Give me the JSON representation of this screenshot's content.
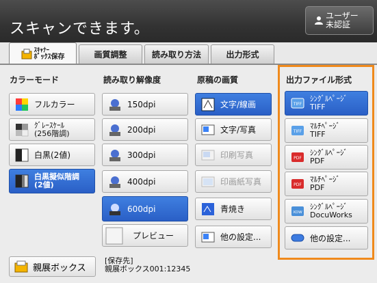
{
  "header": {
    "status": "スキャンできます。",
    "user_line1": "ユーザー",
    "user_line2": "未認証"
  },
  "tabs": {
    "scanbox_line1": "ｽｷｬﾅｰ",
    "scanbox_line2": "ﾎﾞｯｸｽ保存",
    "image_quality": "画質調整",
    "scan_method": "読み取り方法",
    "output_format": "出力形式"
  },
  "color_mode": {
    "heading": "カラーモード",
    "full_color": "フルカラー",
    "gray_line1": "ｸﾞﾚｰｽｹｰﾙ",
    "gray_line2": "(256階調)",
    "bw": "白黒(2値)",
    "bw_pseudo_line1": "白黒擬似階調",
    "bw_pseudo_line2": "(2値)"
  },
  "resolution": {
    "heading": "読み取り解像度",
    "r150": "150dpi",
    "r200": "200dpi",
    "r300": "300dpi",
    "r400": "400dpi",
    "r600": "600dpi",
    "preview": "プレビュー"
  },
  "original_type": {
    "heading": "原稿の画質",
    "text_line": "文字/線画",
    "text_photo": "文字/写真",
    "printed_photo": "印刷写真",
    "photo_paper": "印画紙写真",
    "blueprint": "青焼き",
    "other": "他の設定..."
  },
  "file_format": {
    "heading": "出力ファイル形式",
    "tiff_single_line1": "ｼﾝｸﾞﾙﾍﾟｰｼﾞ",
    "tiff_single_line2": "TIFF",
    "tiff_multi_line1": "ﾏﾙﾁﾍﾟｰｼﾞ",
    "tiff_multi_line2": "TIFF",
    "pdf_single_line1": "ｼﾝｸﾞﾙﾍﾟｰｼﾞ",
    "pdf_single_line2": "PDF",
    "pdf_multi_line1": "ﾏﾙﾁﾍﾟｰｼﾞ",
    "pdf_multi_line2": "PDF",
    "dw_single_line1": "ｼﾝｸﾞﾙﾍﾟｰｼﾞ",
    "dw_single_line2": "DocuWorks",
    "other": "他の設定..."
  },
  "bottom": {
    "parent_box": "親展ボックス",
    "dest_line1": "[保存先]",
    "dest_line2": "親展ボックス001:12345"
  },
  "icons": {
    "tiff_label": "TIFF",
    "pdf_label": "PDF",
    "dw_label": "XDW"
  },
  "colors": {
    "selected": "#2f68d2",
    "highlight_border": "#f08a1c",
    "header": "#333333"
  }
}
